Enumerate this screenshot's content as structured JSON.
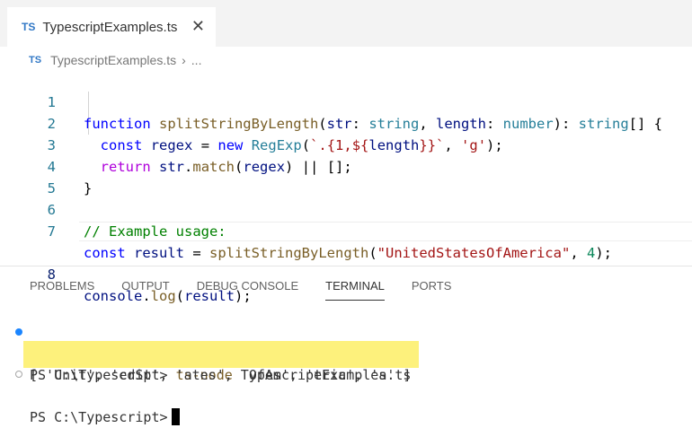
{
  "tab": {
    "badge": "TS",
    "label": "TypescriptExamples.ts",
    "close": "✕"
  },
  "breadcrumb": {
    "badge": "TS",
    "file": "TypescriptExamples.ts",
    "sep": "›",
    "more": "..."
  },
  "editor": {
    "line_numbers": [
      "1",
      "2",
      "3",
      "4",
      "5",
      "6",
      "7",
      "8"
    ],
    "l1": {
      "kw": "function",
      "fn": " splitStringByLength",
      "p1": "(",
      "v1": "str",
      "p2": ": ",
      "t1": "string",
      "p3": ", ",
      "v2": "length",
      "p4": ": ",
      "t2": "number",
      "p5": "): ",
      "t3": "string",
      "p6": "[] {"
    },
    "l2": {
      "indent": "  ",
      "kw": "const",
      "p1": " ",
      "v1": "regex",
      "p2": " = ",
      "kw2": "new",
      "p3": " ",
      "t1": "RegExp",
      "p4": "(",
      "s1": "`.{1,${",
      "v2": "length",
      "s2": "}}`",
      "p5": ", ",
      "s3": "'g'",
      "p6": ");"
    },
    "l3": {
      "indent": "  ",
      "ctl": "return",
      "p1": " ",
      "v1": "str",
      "p2": ".",
      "fn": "match",
      "p3": "(",
      "v2": "regex",
      "p4": ") || [];"
    },
    "l4": {
      "code": "}"
    },
    "l6": {
      "cmt": "// Example usage:"
    },
    "l7": {
      "kw": "const",
      "p1": " ",
      "v1": "result",
      "p2": " = ",
      "fn": "splitStringByLength",
      "p3": "(",
      "s1": "\"UnitedStatesOfAmerica\"",
      "p4": ", ",
      "n1": "4",
      "p5": ");"
    },
    "l8": {
      "v1": "console",
      "p1": ".",
      "fn": "log",
      "p2": "(",
      "v2": "result",
      "p3": ");"
    }
  },
  "panel": {
    "tabs": [
      "PROBLEMS",
      "OUTPUT",
      "DEBUG CONSOLE",
      "TERMINAL",
      "PORTS"
    ]
  },
  "terminal": {
    "prompt": "PS C:\\Typescript> ",
    "command": "ts-node",
    "arg": " TypescriptExamples.ts",
    "output": "[ 'Unit', 'edSt', 'ates', 'OfAm', 'eric', 'a' ]",
    "prompt2": "PS C:\\Typescript>"
  },
  "colors": {
    "accent": "#3178c6",
    "highlight": "#fdf17c",
    "keyword": "#0000ff",
    "string": "#a31515"
  }
}
